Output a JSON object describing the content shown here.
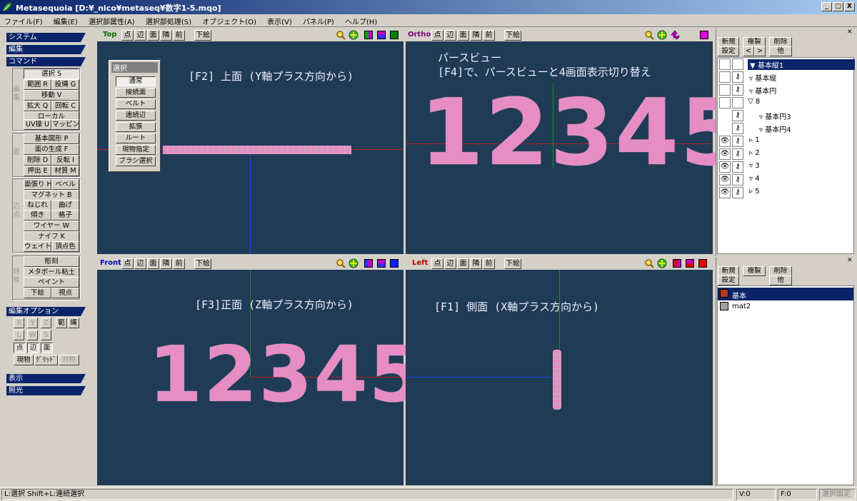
{
  "window": {
    "title": "Metasequoia [D:¥_nico¥metaseq¥数字1-5.mqo]",
    "controls": [
      "_",
      "□",
      "X"
    ]
  },
  "menubar": [
    "ファイル(F)",
    "編集(E)",
    "選択部属性(A)",
    "選択部処理(S)",
    "オブジェクト(O)",
    "表示(V)",
    "パネル(P)",
    "ヘルプ(H)"
  ],
  "left_panel": {
    "sections": {
      "system": "システム",
      "edit": "編集",
      "command": "コマンド",
      "edit_options": "編集オプション",
      "display": "表示",
      "lighting": "照光"
    },
    "group_labels": {
      "edit": "編集",
      "face": "面",
      "edge_point": "辺・点",
      "special": "特殊"
    },
    "edit_buttons": [
      "選択 S",
      "範囲 R",
      "投縄 G",
      "移動 V",
      "拡大 Q",
      "回転 C",
      "ローカル",
      "UV操 U",
      "マッピング"
    ],
    "face_buttons": [
      "基本図形 P",
      "面の生成 F",
      "削除 D",
      "反転 I",
      "押出 E",
      "材質 M"
    ],
    "edge_buttons": [
      "面張り H",
      "ベベル",
      "マグネット B",
      "ねじれ",
      "曲げ",
      "傾き",
      "格子",
      "ワイヤー W",
      "ナイフ K",
      "ウェイト",
      "頂点色"
    ],
    "special_buttons": [
      "彫刻",
      "メタボール粘土",
      "ペイント",
      "下絵",
      "視点"
    ],
    "option_buttons": [
      "X",
      "Y",
      "Z",
      "範",
      "縄",
      "L",
      "W",
      "S",
      "点",
      "辺",
      "面",
      "現物",
      "ｸﾞﾘｯﾄﾞ",
      "対称"
    ]
  },
  "select_popup": {
    "title": "選択",
    "items": [
      "通常",
      "接続面",
      "ベルト",
      "連続辺",
      "拡張",
      "ルート",
      "現物指定",
      "ブラシ選択"
    ]
  },
  "viewports": {
    "toolbar": [
      "点",
      "辺",
      "面",
      "隣",
      "前",
      "下絵"
    ],
    "top": {
      "name": "Top",
      "label": "[F2] 上面 (Y軸プラス方向から)",
      "name_color": "#007000"
    },
    "ortho": {
      "name": "Ortho",
      "label1": "パースビュー",
      "label2": "[F4]で、パースビューと4画面表示切り替え",
      "digits": "12345",
      "name_color": "#800080"
    },
    "front": {
      "name": "Front",
      "label": "[F3]正面 (Z軸プラス方向から)",
      "digits": "12345",
      "name_color": "#0000c0"
    },
    "left": {
      "name": "Left",
      "label": "[F1] 側面 (X軸プラス方向から)",
      "name_color": "#c00000"
    }
  },
  "object_panel": {
    "buttons": [
      "新規",
      "複製",
      "削除",
      "設定",
      "<",
      ">",
      "他"
    ],
    "objects": [
      {
        "name": "基本縦1",
        "selected": true
      },
      {
        "name": "基本縦"
      },
      {
        "name": "基本円"
      },
      {
        "name": "8"
      },
      {
        "name": "基本円3"
      },
      {
        "name": "基本円4"
      },
      {
        "name": "1"
      },
      {
        "name": "2"
      },
      {
        "name": "3"
      },
      {
        "name": "4"
      },
      {
        "name": "5"
      }
    ]
  },
  "material_panel": {
    "buttons": [
      "新規",
      "複製",
      "削除",
      "設定",
      "他"
    ],
    "materials": [
      {
        "name": "基本",
        "color": "#b03a20",
        "selected": true
      },
      {
        "name": "mat2",
        "color": "#a0a0a0"
      }
    ]
  },
  "statusbar": {
    "hint": "L:選択   Shift+L:連続選択",
    "vertices": "V:0",
    "faces": "F:0",
    "lock": "選択固定"
  },
  "colors": {
    "viewport_bg": "#1f3b55",
    "mesh": "#e68ec4",
    "selection": "#0a246a"
  }
}
